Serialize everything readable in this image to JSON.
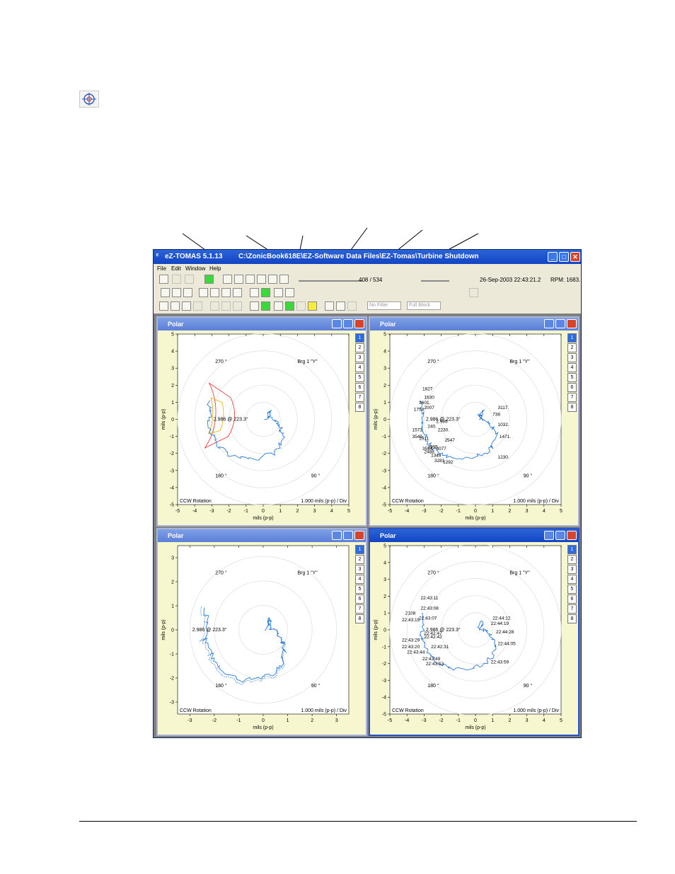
{
  "window": {
    "app_name": "eZ-TOMAS 5.1.13",
    "path": "C:\\ZonicBook618E\\EZ-Software Data Files\\EZ-Tomas\\Turbine Shutdown"
  },
  "menu": [
    "File",
    "Edit",
    "Window",
    "Help"
  ],
  "toolbar": {
    "sample_counter": "408 / 534",
    "timestamp": "26-Sep-2003 22:43:21.2",
    "rpm": "RPM: 1683.",
    "filter": "No Filter",
    "block": "Full Block"
  },
  "panes": [
    {
      "title": "Polar",
      "bearing": "Brg 1 \"Y\"",
      "angle_270": "270 °",
      "angle_180": "180 °",
      "angle_90": "90 °",
      "rotation": "CCW Rotation",
      "scale": "1.000 mils (p-p) / Div",
      "ylabel": "mils (p-p)",
      "xlabel": "mils (p-p)",
      "cursor": "2.986 @ 223.3°"
    },
    {
      "title": "Polar",
      "bearing": "Brg 1 \"Y\"",
      "angle_270": "270 °",
      "angle_180": "180 °",
      "angle_90": "90 °",
      "rotation": "CCW Rotation",
      "scale": "1.000 mils (p-p) / Div",
      "ylabel": "mils (p-p)",
      "xlabel": "mils (p-p)",
      "cursor": "2.986 @ 223.3°"
    },
    {
      "title": "Polar",
      "bearing": "Brg 1 \"Y\"",
      "angle_180": "180 °",
      "angle_90": "90 °",
      "angle_270": "270 °",
      "rotation": "CCW Rotation",
      "scale": "1.000 mils (p-p) / Div",
      "ylabel": "mils (p-p)",
      "xlabel": "mils (p-p)",
      "cursor": "2.986 @ 223.3°"
    },
    {
      "title": "Polar",
      "bearing": "Brg 1 \"Y\"",
      "angle_270": "270 °",
      "angle_180": "180 °",
      "angle_90": "90 °",
      "rotation": "CCW Rotation",
      "scale": "1.000 mils (p-p) / Div",
      "ylabel": "mils (p-p)",
      "xlabel": "mils (p-p)",
      "cursor": "2.986 @ 223.3°"
    }
  ],
  "tabs": [
    "1",
    "2",
    "3",
    "4",
    "5",
    "6",
    "7",
    "8"
  ],
  "rpm_labels": [
    "1827",
    "1630",
    "3601.",
    "1758",
    "2007",
    "2.986",
    "240.",
    "2230.",
    "1573",
    "3549",
    "1911",
    "2547",
    "3594",
    "3995",
    "3077",
    "1349",
    "3281",
    "1292",
    "2488",
    "738",
    "3117.",
    "1032.",
    "1471.",
    "1230."
  ],
  "time_labels": [
    "22:43:11",
    "22:43:08",
    "2108",
    "22:43:07",
    "22:43:15",
    "22:42:47",
    "22:43:29",
    "22:42:42",
    "22:43:20",
    "22:42:31",
    "22:43:44",
    "22:43:49",
    "22:43:53",
    "22:44:12",
    "22:44:19",
    "22:44:28",
    "22:44:05",
    "22:43:59"
  ],
  "chart_data": [
    {
      "type": "scatter",
      "title": "Polar",
      "xlabel": "mils (p-p)",
      "ylabel": "mils (p-p)",
      "xlim": [
        -5,
        5
      ],
      "ylim": [
        -5,
        5
      ],
      "x_ticks": [
        -5,
        -4,
        -3,
        -2,
        -1,
        0,
        1,
        2,
        3,
        4,
        5
      ],
      "y_ticks": [
        -5,
        -4,
        -3,
        -2,
        -1,
        0,
        1,
        2,
        3,
        4,
        5
      ]
    },
    {
      "type": "scatter",
      "title": "Polar",
      "xlabel": "mils (p-p)",
      "ylabel": "mils (p-p)",
      "xlim": [
        -5,
        5
      ],
      "ylim": [
        -5,
        5
      ],
      "x_ticks": [
        -5,
        -4,
        -3,
        -2,
        -1,
        0,
        1,
        2,
        3,
        4,
        5
      ],
      "y_ticks": [
        -5,
        -4,
        -3,
        -2,
        -1,
        0,
        1,
        2,
        3,
        4,
        5
      ]
    },
    {
      "type": "scatter",
      "title": "Polar",
      "xlabel": "mils (p-p)",
      "ylabel": "mils (p-p)",
      "xlim": [
        -3.5,
        3.5
      ],
      "ylim": [
        -3.5,
        3.5
      ],
      "x_ticks": [
        -3,
        -2,
        -1,
        0,
        1,
        2,
        3
      ],
      "y_ticks": [
        -3,
        -2,
        -1,
        0,
        1,
        2,
        3
      ]
    },
    {
      "type": "scatter",
      "title": "Polar",
      "xlabel": "mils (p-p)",
      "ylabel": "mils (p-p)",
      "xlim": [
        -5,
        5
      ],
      "ylim": [
        -5,
        5
      ],
      "x_ticks": [
        -5,
        -4,
        -3,
        -2,
        -1,
        0,
        1,
        2,
        3,
        4,
        5
      ],
      "y_ticks": [
        -5,
        -4,
        -3,
        -2,
        -1,
        0,
        1,
        2,
        3,
        4,
        5
      ]
    }
  ]
}
